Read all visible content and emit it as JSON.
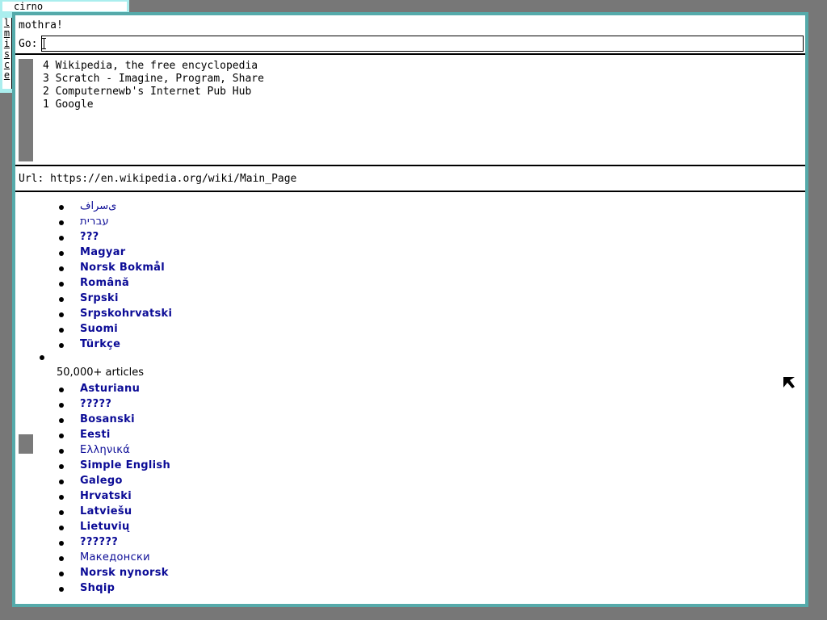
{
  "background_window": {
    "title": "cirno",
    "tab_letters": [
      "l",
      "m",
      "i",
      "s",
      "c",
      "e"
    ]
  },
  "browser": {
    "app_name": "mothra!",
    "go_label": "Go:",
    "go_value": "",
    "history": [
      "4 Wikipedia, the free encyclopedia",
      "3 Scratch - Imagine, Program, Share",
      "2 Computernewb's Internet Pub Hub",
      "1 Google"
    ],
    "url_label": "Url:",
    "url": "https://en.wikipedia.org/wiki/Main_Page"
  },
  "page": {
    "group1": [
      "ی‌سراف",
      "עברית",
      "???",
      "Magyar",
      "Norsk Bokmål",
      "Română",
      "Srpski",
      "Srpskohrvatski",
      "Suomi",
      "Türkçe"
    ],
    "group2_heading": "50,000+ articles",
    "group2": [
      "Asturianu",
      "?????",
      "Bosanski",
      "Eesti",
      "Ελληνικά",
      "Simple English",
      "Galego",
      "Hrvatski",
      "Latviešu",
      "Lietuvių",
      "??????",
      "Македонски",
      "Norsk nynorsk",
      "Shqip"
    ]
  },
  "colors": {
    "link": "#0b0b96",
    "frame": "#55aaaa",
    "desktop": "#777777",
    "bg_window": "#aaeeee"
  }
}
